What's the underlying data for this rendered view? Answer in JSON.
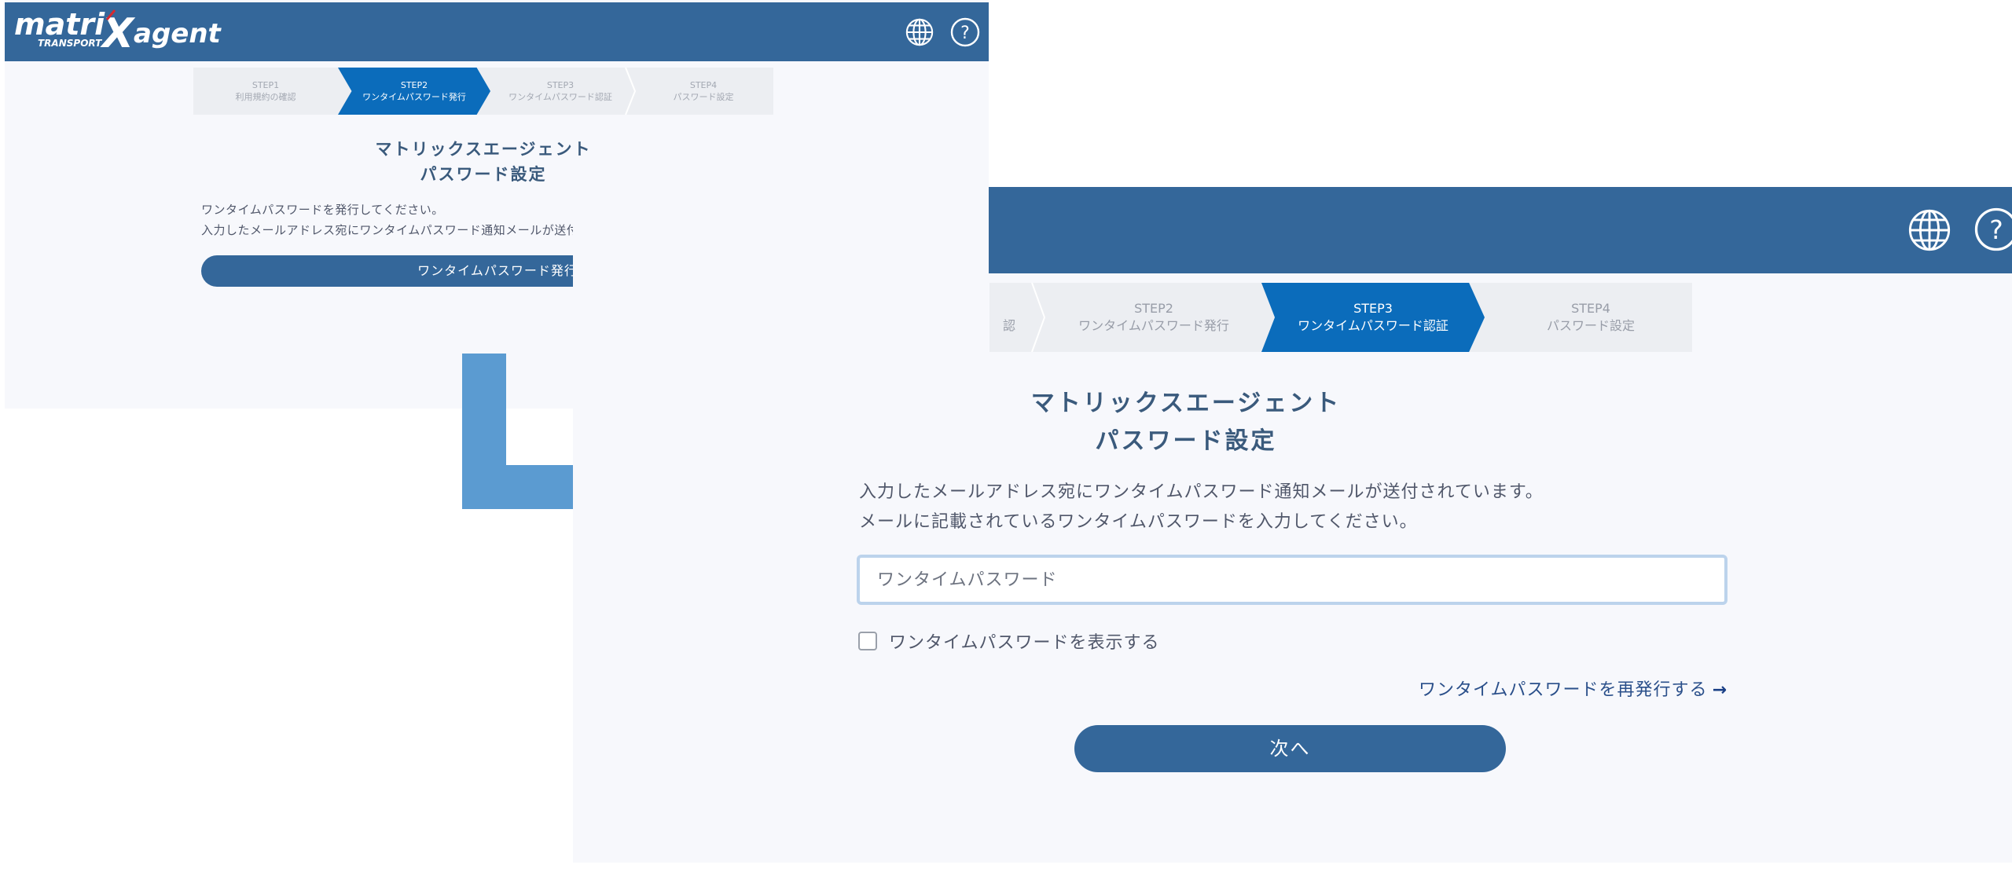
{
  "logo": {
    "matri": "matri",
    "x": "X",
    "agent": "agent",
    "transport": "TRANSPORT"
  },
  "icons": {
    "language": "globe-icon",
    "help": "question-circle-icon"
  },
  "screen1": {
    "steps": [
      {
        "step": "STEP1",
        "label": "利用規約の確認"
      },
      {
        "step": "STEP2",
        "label": "ワンタイムパスワード発行"
      },
      {
        "step": "STEP3",
        "label": "ワンタイムパスワード認証"
      },
      {
        "step": "STEP4",
        "label": "パスワード設定"
      }
    ],
    "active_step": 2,
    "title_line1": "マトリックスエージェント",
    "title_line2": "パスワード設定",
    "desc_line1": "ワンタイムパスワードを発行してください。",
    "desc_line2": "入力したメールアドレス宛にワンタイムパスワード通知メールが送付されます。",
    "issue_button": "ワンタイムパスワード発行"
  },
  "screen2": {
    "steps": [
      {
        "step": "",
        "label": "認"
      },
      {
        "step": "STEP2",
        "label": "ワンタイムパスワード発行"
      },
      {
        "step": "STEP3",
        "label": "ワンタイムパスワード認証"
      },
      {
        "step": "STEP4",
        "label": "パスワード設定"
      }
    ],
    "active_step": 3,
    "title_line1": "マトリックスエージェント",
    "title_line2": "パスワード設定",
    "desc_line1": "入力したメールアドレス宛にワンタイムパスワード通知メールが送付されています。",
    "desc_line2": "メールに記載されているワンタイムパスワードを入力してください。",
    "otp_placeholder": "ワンタイムパスワード",
    "otp_value": "",
    "show_password_label": "ワンタイムパスワードを表示する",
    "show_password_checked": false,
    "resend_link": "ワンタイムパスワードを再発行する",
    "resend_arrow": "→",
    "next_button": "次へ"
  },
  "colors": {
    "header": "#34679a",
    "active_step": "#0b6cbb",
    "arrow": "#5b9bd1",
    "background": "#f7f8fc"
  }
}
